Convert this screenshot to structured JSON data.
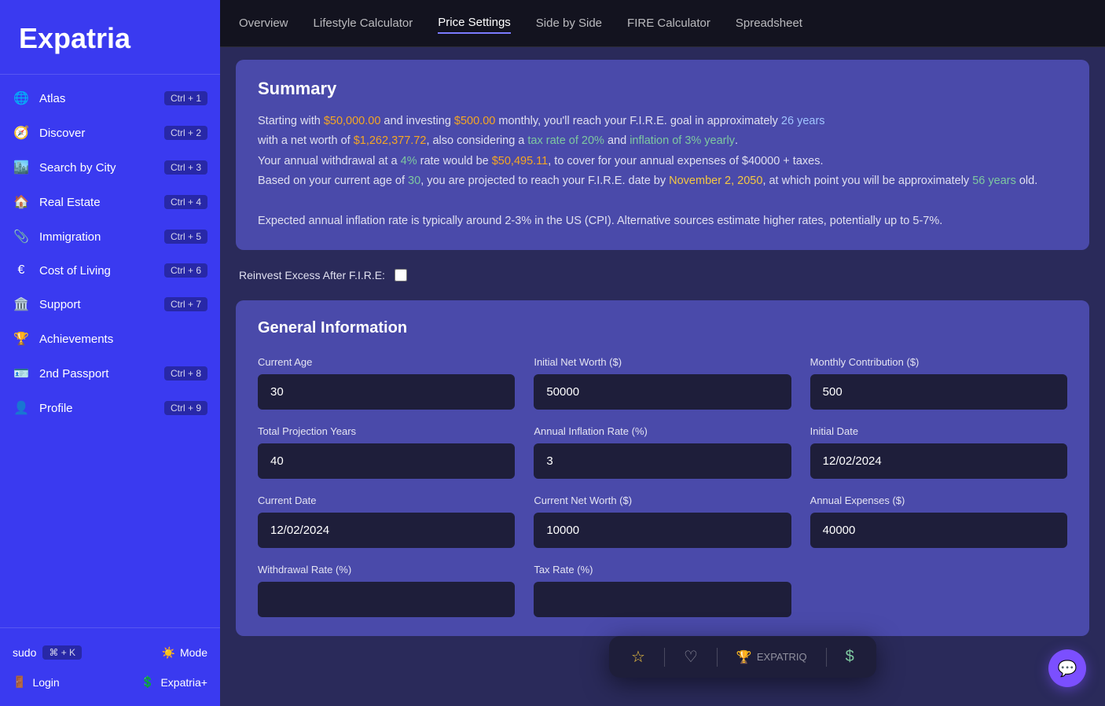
{
  "sidebar": {
    "logo": "Expatria",
    "items": [
      {
        "id": "atlas",
        "label": "Atlas",
        "icon": "🌐",
        "shortcut": "Ctrl + 1"
      },
      {
        "id": "discover",
        "label": "Discover",
        "icon": "🧭",
        "shortcut": "Ctrl + 2"
      },
      {
        "id": "search-by-city",
        "label": "Search by City",
        "icon": "🏙️",
        "shortcut": "Ctrl + 3"
      },
      {
        "id": "real-estate",
        "label": "Real Estate",
        "icon": "🏠",
        "shortcut": "Ctrl + 4"
      },
      {
        "id": "immigration",
        "label": "Immigration",
        "icon": "📎",
        "shortcut": "Ctrl + 5"
      },
      {
        "id": "cost-of-living",
        "label": "Cost of Living",
        "icon": "€",
        "shortcut": "Ctrl + 6"
      },
      {
        "id": "support",
        "label": "Support",
        "icon": "🏛️",
        "shortcut": "Ctrl + 7"
      },
      {
        "id": "achievements",
        "label": "Achievements",
        "icon": "🏆",
        "shortcut": ""
      },
      {
        "id": "2nd-passport",
        "label": "2nd Passport",
        "icon": "🪪",
        "shortcut": "Ctrl + 8"
      },
      {
        "id": "profile",
        "label": "Profile",
        "icon": "👤",
        "shortcut": "Ctrl + 9"
      }
    ],
    "bottom": {
      "sudo_label": "sudo",
      "sudo_shortcut": "⌘ + K",
      "mode_label": "Mode",
      "login_label": "Login",
      "expatria_plus_label": "Expatria+"
    }
  },
  "topnav": {
    "items": [
      {
        "id": "overview",
        "label": "Overview"
      },
      {
        "id": "lifestyle-calculator",
        "label": "Lifestyle Calculator"
      },
      {
        "id": "price-settings",
        "label": "Price Settings",
        "active": true
      },
      {
        "id": "side-by-side",
        "label": "Side by Side"
      },
      {
        "id": "fire-calculator",
        "label": "FIRE Calculator"
      },
      {
        "id": "spreadsheet",
        "label": "Spreadsheet"
      }
    ]
  },
  "summary": {
    "title": "Summary",
    "text_prefix": "Starting with ",
    "initial_investment": "$50,000.00",
    "text_and_investing": " and investing ",
    "monthly_contribution": "$500.00",
    "text_monthly": " monthly, you'll reach your F.I.R.E. goal in approximately ",
    "years": "26 years",
    "text_net_worth": " with a net worth of ",
    "net_worth": "$1,262,377.72",
    "text_considering": ", also considering a ",
    "tax_rate": "tax rate of 20%",
    "text_and": " and ",
    "inflation": "inflation of 3% yearly",
    "text_period": ".",
    "text_annual_withdrawal": "Your annual withdrawal at a ",
    "withdrawal_rate": "4%",
    "text_rate_would_be": " rate would be ",
    "annual_withdrawal": "$50,495.11",
    "text_cover": ", to cover for your annual expenses of $40000 + taxes.",
    "text_based": "Based on your current age of ",
    "current_age_text": "30",
    "text_projected": ", you are projected to reach your F.I.R.E. date by ",
    "fire_date": "November 2, 2050",
    "text_at_which": ", at which point you will be approximately ",
    "age_at_fire": "56 years",
    "text_old": " old.",
    "text_inflation_note": "Expected annual inflation rate is typically around 2-3% in the US (CPI). Alternative sources estimate higher rates, potentially up to 5-7%."
  },
  "reinvest": {
    "label": "Reinvest Excess After F.I.R.E:"
  },
  "general_info": {
    "title": "General Information",
    "fields": [
      {
        "id": "current-age",
        "label": "Current Age",
        "value": "30"
      },
      {
        "id": "initial-net-worth",
        "label": "Initial Net Worth ($)",
        "value": "50000"
      },
      {
        "id": "monthly-contribution",
        "label": "Monthly Contribution ($)",
        "value": "500"
      },
      {
        "id": "total-projection-years",
        "label": "Total Projection Years",
        "value": "40"
      },
      {
        "id": "annual-inflation-rate",
        "label": "Annual Inflation Rate (%)",
        "value": "3"
      },
      {
        "id": "initial-date",
        "label": "Initial Date",
        "value": "12/02/2024"
      },
      {
        "id": "current-date",
        "label": "Current Date",
        "value": "12/02/2024"
      },
      {
        "id": "current-net-worth",
        "label": "Current Net Worth ($)",
        "value": "10000"
      },
      {
        "id": "annual-expenses",
        "label": "Annual Expenses ($)",
        "value": "40000"
      }
    ],
    "row3_labels": [
      "Withdrawal Rate (%)",
      "Tax Rate (%)"
    ]
  },
  "popup": {
    "star_icon": "☆",
    "brand_text": "EXPATRIQ",
    "dollar_icon": "$"
  },
  "chat": {
    "icon": "💬"
  }
}
